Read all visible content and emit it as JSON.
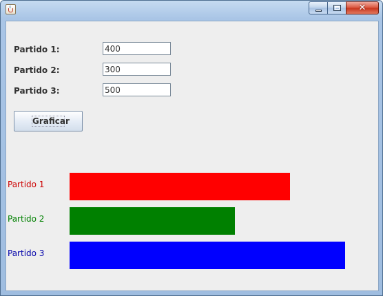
{
  "window": {
    "icon": "java-cup-icon",
    "controls": {
      "minimize_icon": "minimize-icon",
      "maximize_icon": "maximize-icon",
      "close_icon": "close-icon",
      "close_glyph": "✕"
    }
  },
  "form": {
    "fields": [
      {
        "label": "Partido 1:",
        "value": "400"
      },
      {
        "label": "Partido 2:",
        "value": "300"
      },
      {
        "label": "Partido 3:",
        "value": "500"
      }
    ],
    "button_label": "Graficar"
  },
  "chart_data": {
    "type": "bar",
    "orientation": "horizontal",
    "categories": [
      "Partido 1",
      "Partido 2",
      "Partido 3"
    ],
    "values": [
      400,
      300,
      500
    ],
    "colors": [
      "#ff0000",
      "#008000",
      "#0000ff"
    ],
    "label_colors": [
      "#cc0000",
      "#008000",
      "#0000aa"
    ],
    "xlim": [
      0,
      500
    ],
    "grid": false
  }
}
